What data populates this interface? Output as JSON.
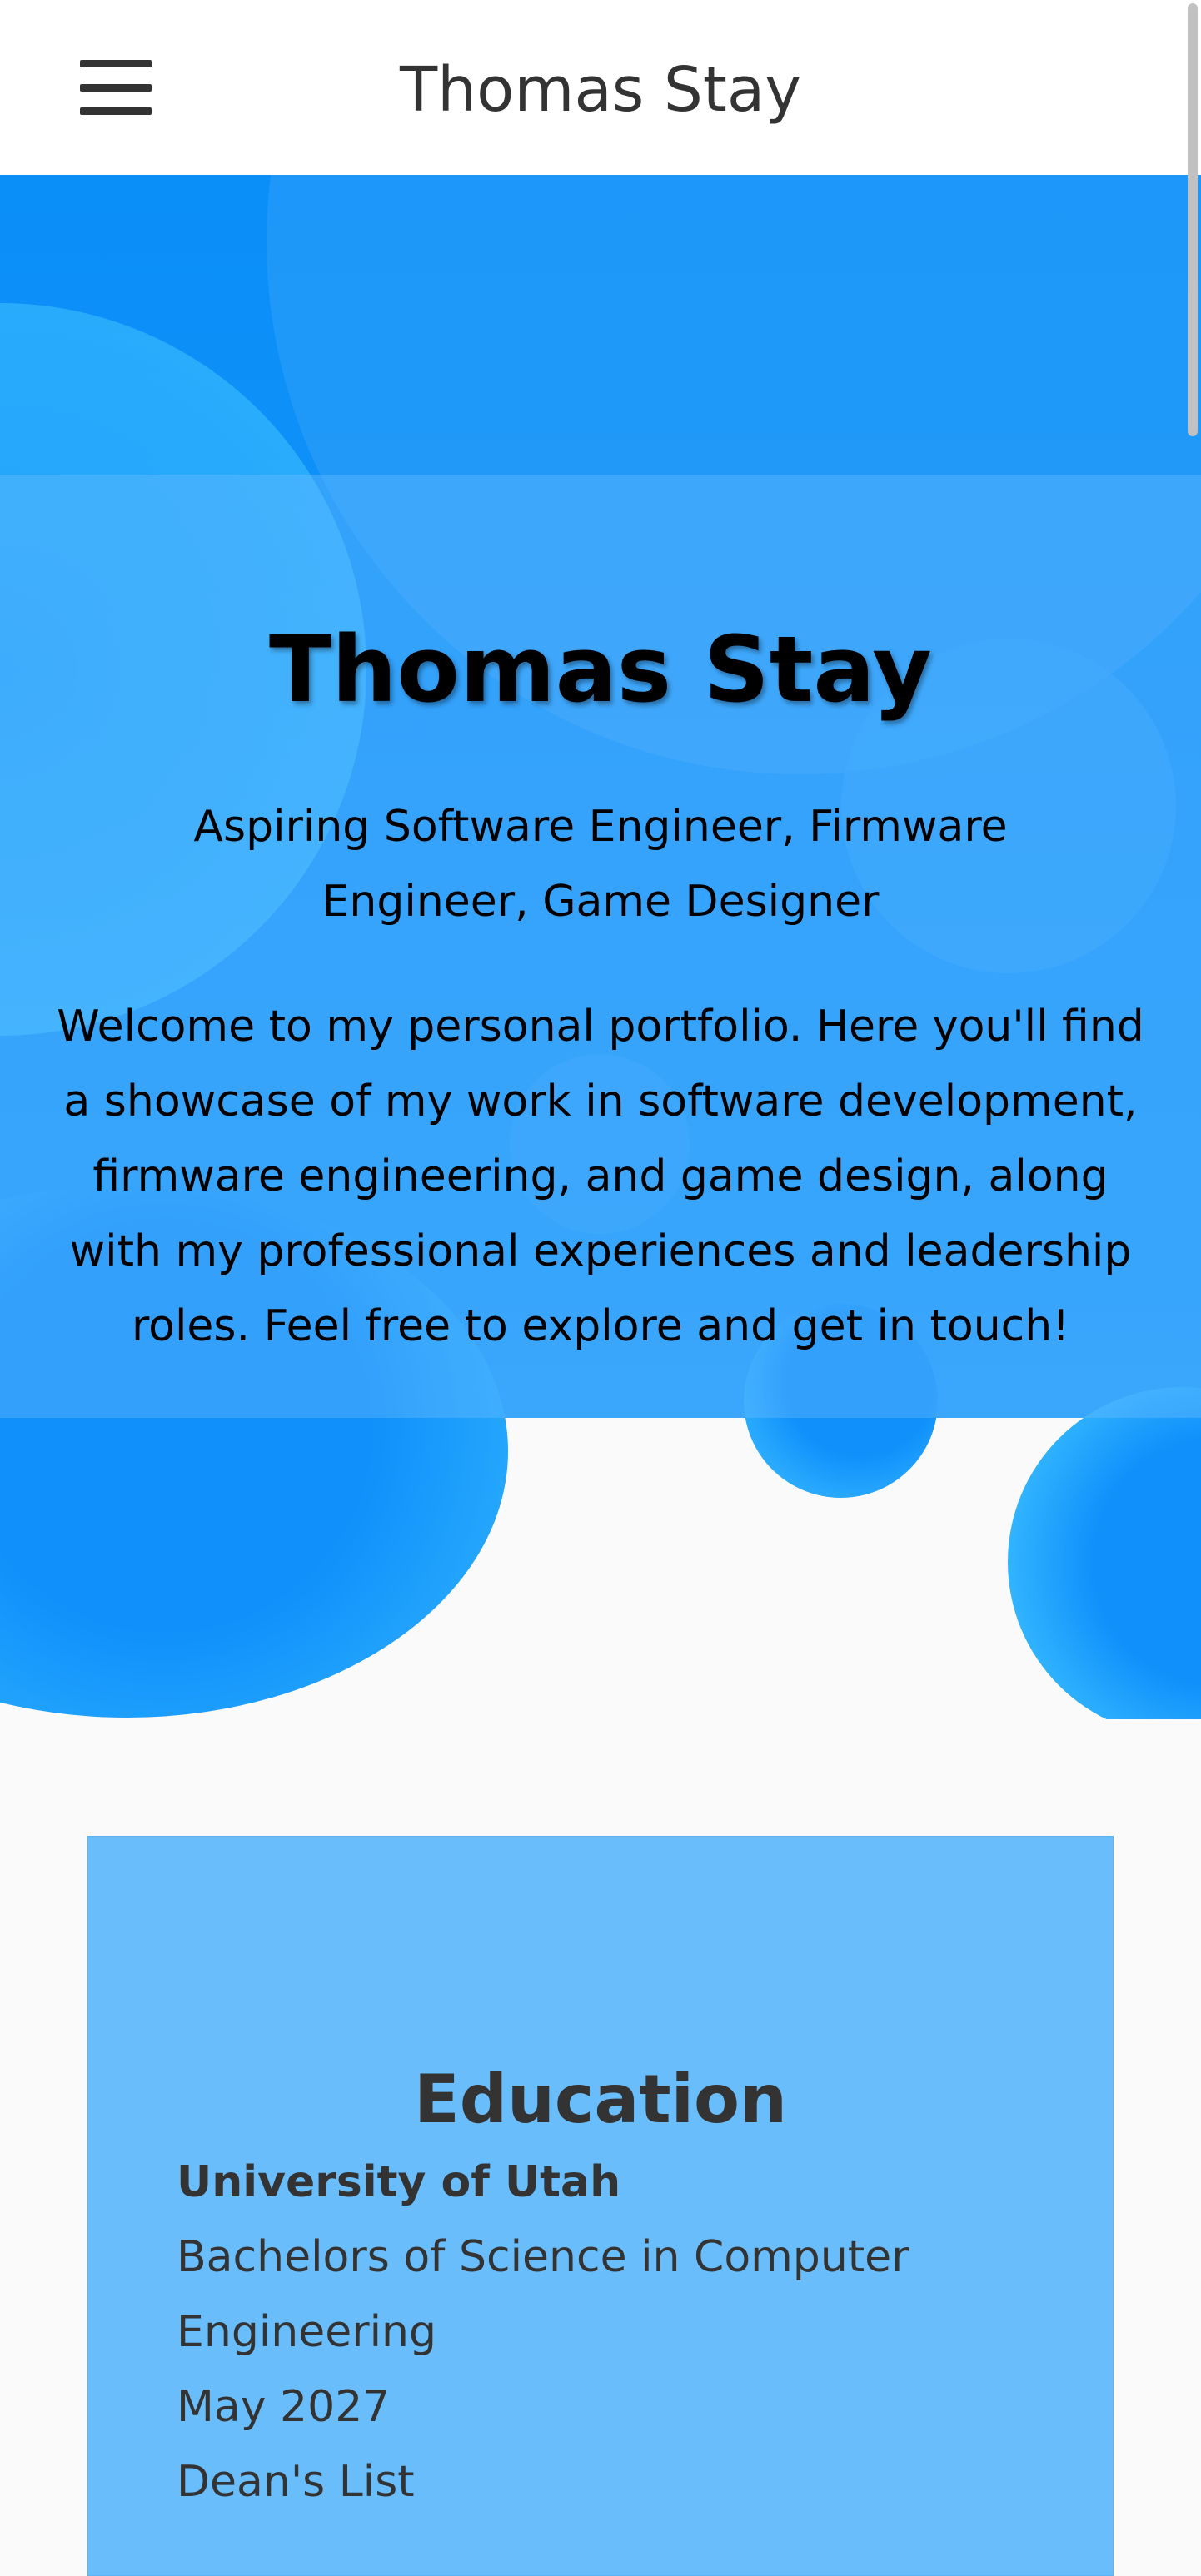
{
  "nav": {
    "title": "Thomas Stay",
    "menu_icon": "hamburger-menu-icon"
  },
  "hero": {
    "name": "Thomas Stay",
    "tagline": "Aspiring Software Engineer, Firmware Engineer, Game Designer",
    "welcome": "Welcome to my personal portfolio. Here you'll find a showcase of my work in software development, firmware engineering, and game design, along with my professional experiences and leadership roles. Feel free to explore and get in touch!"
  },
  "education": {
    "heading": "Education",
    "school": "University of Utah",
    "degree": "Bachelors of Science in Computer Engineering",
    "graduation": "May 2027",
    "honors": "Dean's List"
  },
  "colors": {
    "accent": "#0a8ef8",
    "card": "#6abdfb",
    "text": "#333333",
    "background": "#fafafa"
  }
}
